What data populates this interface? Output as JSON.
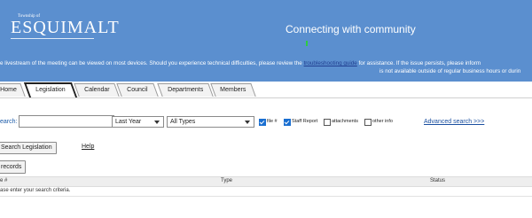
{
  "header": {
    "logo_small": "Township of",
    "logo": "ESQUIMALT",
    "tagline": "Connecting with community",
    "notice_line1_pre": "e livestream of the meeting can be viewed on most devices. Should you experience technical difficulties, please review the ",
    "notice_link": "troubleshooting guide",
    "notice_line1_post": " for assistance. If the issue persists, please inform",
    "notice_line2": "is not available outside of regular business hours or durin"
  },
  "tabs": [
    {
      "label": "Home"
    },
    {
      "label": "Legislation"
    },
    {
      "label": "Calendar"
    },
    {
      "label": "Council"
    },
    {
      "label": "Departments"
    },
    {
      "label": "Members"
    }
  ],
  "search": {
    "label": "earch:",
    "value": "",
    "time_select": "Last Year",
    "type_select": "All Types",
    "checkboxes": [
      {
        "label": "file #",
        "checked": true
      },
      {
        "label": "Staff Report",
        "checked": true
      },
      {
        "label": "attachments",
        "checked": false
      },
      {
        "label": "other info",
        "checked": false
      }
    ],
    "advanced_link": "Advanced search >>>",
    "search_button": "Search Legislation",
    "help_link": "Help",
    "records_button": "records"
  },
  "table": {
    "columns": [
      "e #",
      "Type",
      "Status"
    ],
    "empty_message": "ase enter your search criteria."
  }
}
